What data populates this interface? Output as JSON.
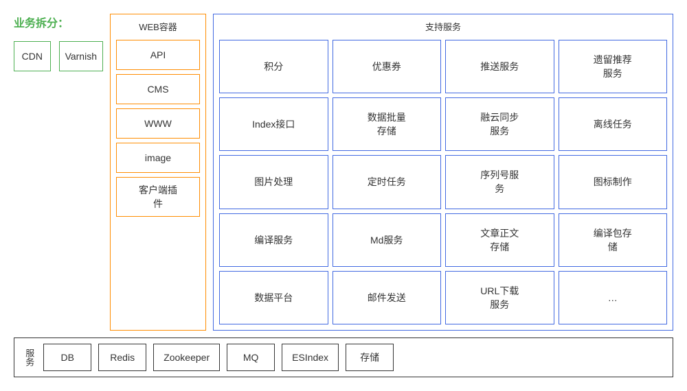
{
  "business_label": "业务拆分：",
  "cdn_label": "CDN",
  "varnish_label": "Varnish",
  "web_container": {
    "title": "WEB容器",
    "items": [
      "API",
      "CMS",
      "WWW",
      "image",
      "客户端插\n件"
    ]
  },
  "support_services": {
    "title": "支持服务",
    "items": [
      "积分",
      "优惠券",
      "推送服务",
      "遗留推荐\n服务",
      "Index接口",
      "数据批量\n存储",
      "融云同步\n服务",
      "离线任务",
      "图片处理",
      "定时任务",
      "序列号服\n务",
      "图标制作",
      "编译服务",
      "Md服务",
      "文章正文\n存储",
      "编译包存\n储",
      "数据平台",
      "邮件发送",
      "URL下载\n服务",
      "…"
    ]
  },
  "bottom": {
    "label": "服务",
    "items": [
      "DB",
      "Redis",
      "Zookeeper",
      "MQ",
      "ESIndex",
      "存储"
    ]
  }
}
